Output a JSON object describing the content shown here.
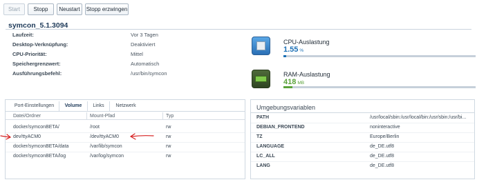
{
  "toolbar": {
    "start": "Start",
    "stop": "Stopp",
    "restart": "Neustart",
    "force_stop": "Stopp erzwingen"
  },
  "container": {
    "name": "symcon_5.1.3094",
    "fields": [
      {
        "label": "Laufzeit:",
        "value": "Vor 3 Tagen"
      },
      {
        "label": "Desktop-Verknüpfung:",
        "value": "Deaktiviert"
      },
      {
        "label": "CPU-Priorität:",
        "value": "Mittel"
      },
      {
        "label": "Speichergrenzwert:",
        "value": "Automatisch"
      },
      {
        "label": "Ausführungsbefehl:",
        "value": "/usr/bin/symcon"
      }
    ]
  },
  "monitor": {
    "cpu": {
      "label": "CPU-Auslastung",
      "value": "1.55",
      "unit": "%",
      "percent": 1.55,
      "color": "#1a6fb5"
    },
    "ram": {
      "label": "RAM-Auslastung",
      "value": "418",
      "unit": "MB",
      "percent": 4.5,
      "color": "#5aa23a"
    }
  },
  "tabs": [
    {
      "label": "Port-Einstellungen",
      "active": false
    },
    {
      "label": "Volume",
      "active": true
    },
    {
      "label": "Links",
      "active": false
    },
    {
      "label": "Netzwerk",
      "active": false
    }
  ],
  "volume_table": {
    "headers": [
      "Datei/Ordner",
      "Mount-Pfad",
      "Typ"
    ],
    "rows": [
      [
        "docker/symconBETA/",
        "/root",
        "rw"
      ],
      [
        "dev/ttyACM0",
        "/dev/ttyACM0",
        "rw"
      ],
      [
        "docker/symconBETA/data",
        "/var/lib/symcon",
        "rw"
      ],
      [
        "docker/symconBETA/log",
        "/var/log/symcon",
        "rw"
      ]
    ]
  },
  "env": {
    "title": "Umgebungsvariablen",
    "rows": [
      {
        "key": "PATH",
        "value": "/usr/local/sbin:/usr/local/bin:/usr/sbin:/usr/bi..."
      },
      {
        "key": "DEBIAN_FRONTEND",
        "value": "noninteractive"
      },
      {
        "key": "TZ",
        "value": "Europe/Berlin"
      },
      {
        "key": "LANGUAGE",
        "value": "de_DE.utf8"
      },
      {
        "key": "LC_ALL",
        "value": "de_DE.utf8"
      },
      {
        "key": "LANG",
        "value": "de_DE.utf8"
      }
    ]
  },
  "annotation_color": "#d62020"
}
